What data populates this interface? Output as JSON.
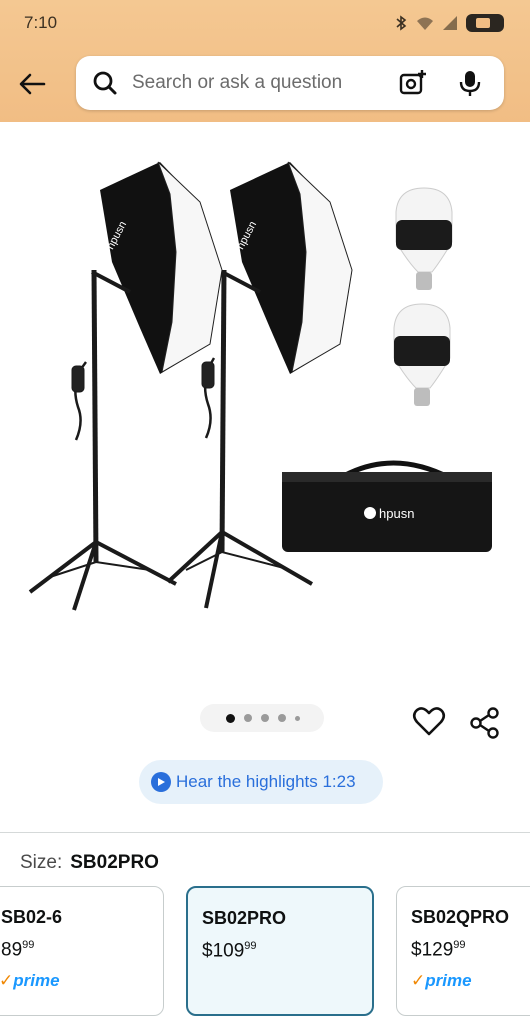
{
  "status_bar": {
    "time": "7:10"
  },
  "search": {
    "placeholder": "Search or ask a question"
  },
  "gallery": {
    "image_count": 5,
    "active_index": 0
  },
  "highlights": {
    "label": "Hear the highlights 1:23"
  },
  "product_image": {
    "bag_brand": "hpusn"
  },
  "size": {
    "label": "Size:",
    "selected": "SB02PRO",
    "options": [
      {
        "name": "SB02-6",
        "price_whole": "89",
        "price_fraction": "99",
        "prime": "prime",
        "selected": false
      },
      {
        "name": "SB02PRO",
        "price_whole": "$109",
        "price_fraction": "99",
        "prime": "",
        "selected": true
      },
      {
        "name": "SB02QPRO",
        "price_whole": "$129",
        "price_fraction": "99",
        "prime": "prime",
        "selected": false
      }
    ]
  },
  "colors": {
    "header": "#f2c28b",
    "link": "#2a6fdb",
    "selected_border": "#2a6f8c"
  }
}
